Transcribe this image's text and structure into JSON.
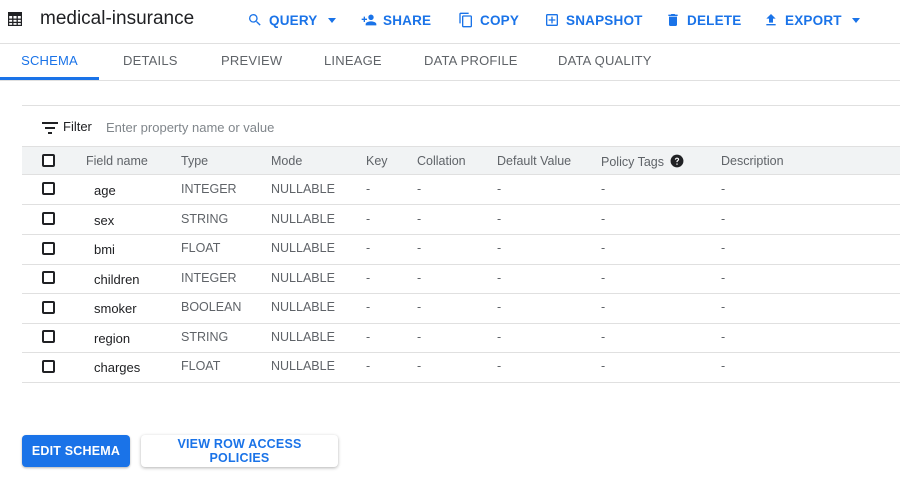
{
  "header": {
    "title": "medical-insurance",
    "actions": {
      "query": "QUERY",
      "share": "SHARE",
      "copy": "COPY",
      "snapshot": "SNAPSHOT",
      "delete": "DELETE",
      "export": "EXPORT"
    }
  },
  "tabs": {
    "schema": "SCHEMA",
    "details": "DETAILS",
    "preview": "PREVIEW",
    "lineage": "LINEAGE",
    "data_profile": "DATA PROFILE",
    "data_quality": "DATA QUALITY",
    "active": "schema"
  },
  "filter": {
    "label": "Filter",
    "placeholder": "Enter property name or value"
  },
  "columns": {
    "field_name": "Field name",
    "type": "Type",
    "mode": "Mode",
    "key": "Key",
    "collation": "Collation",
    "default_value": "Default Value",
    "policy_tags": "Policy Tags",
    "description": "Description"
  },
  "rows": [
    {
      "name": "age",
      "type": "INTEGER",
      "mode": "NULLABLE",
      "key": "-",
      "collation": "-",
      "default_value": "-",
      "policy_tags": "-",
      "description": "-"
    },
    {
      "name": "sex",
      "type": "STRING",
      "mode": "NULLABLE",
      "key": "-",
      "collation": "-",
      "default_value": "-",
      "policy_tags": "-",
      "description": "-"
    },
    {
      "name": "bmi",
      "type": "FLOAT",
      "mode": "NULLABLE",
      "key": "-",
      "collation": "-",
      "default_value": "-",
      "policy_tags": "-",
      "description": "-"
    },
    {
      "name": "children",
      "type": "INTEGER",
      "mode": "NULLABLE",
      "key": "-",
      "collation": "-",
      "default_value": "-",
      "policy_tags": "-",
      "description": "-"
    },
    {
      "name": "smoker",
      "type": "BOOLEAN",
      "mode": "NULLABLE",
      "key": "-",
      "collation": "-",
      "default_value": "-",
      "policy_tags": "-",
      "description": "-"
    },
    {
      "name": "region",
      "type": "STRING",
      "mode": "NULLABLE",
      "key": "-",
      "collation": "-",
      "default_value": "-",
      "policy_tags": "-",
      "description": "-"
    },
    {
      "name": "charges",
      "type": "FLOAT",
      "mode": "NULLABLE",
      "key": "-",
      "collation": "-",
      "default_value": "-",
      "policy_tags": "-",
      "description": "-"
    }
  ],
  "buttons": {
    "edit_schema": "EDIT SCHEMA",
    "view_row_access": "VIEW ROW ACCESS POLICIES"
  },
  "colors": {
    "accent": "#1a73e8",
    "text": "#202124",
    "muted": "#5f6368",
    "divider": "#e0e0e0",
    "header_bg": "#f1f3f4"
  },
  "icons": {
    "table": "table-icon",
    "query": "search-icon",
    "share": "person-add-icon",
    "copy": "copy-icon",
    "snapshot": "snapshot-icon",
    "delete": "trash-icon",
    "export": "upload-icon",
    "filter": "filter-icon",
    "help": "help-icon"
  }
}
